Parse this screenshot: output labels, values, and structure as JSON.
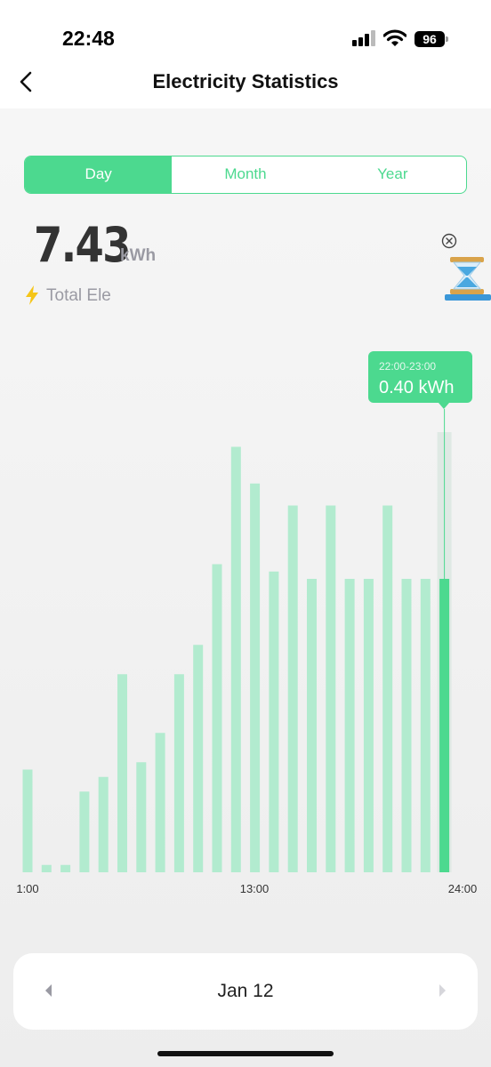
{
  "status_bar": {
    "time": "22:48",
    "battery": "96"
  },
  "header": {
    "title": "Electricity Statistics"
  },
  "tabs": [
    {
      "label": "Day",
      "active": true
    },
    {
      "label": "Month",
      "active": false
    },
    {
      "label": "Year",
      "active": false
    }
  ],
  "summary": {
    "value": "7.43",
    "unit": "kWh",
    "label": "Total Ele"
  },
  "tooltip": {
    "range": "22:00-23:00",
    "value": "0.40 kWh"
  },
  "date_nav": {
    "date": "Jan 12"
  },
  "colors": {
    "accent": "#4cd98f",
    "bar": "#b2ebcf",
    "bolt": "#f5c518"
  },
  "chart_data": {
    "type": "bar",
    "tick_labels": [
      "1:00",
      "13:00",
      "24:00"
    ],
    "categories": [
      "1",
      "2",
      "3",
      "4",
      "5",
      "6",
      "7",
      "8",
      "9",
      "10",
      "11",
      "12",
      "13",
      "14",
      "15",
      "16",
      "17",
      "18",
      "19",
      "20",
      "21",
      "22",
      "23",
      "24"
    ],
    "values": [
      0.14,
      0.01,
      0.01,
      0.11,
      0.13,
      0.27,
      0.15,
      0.19,
      0.27,
      0.31,
      0.42,
      0.58,
      0.53,
      0.41,
      0.5,
      0.4,
      0.5,
      0.4,
      0.4,
      0.5,
      0.4,
      0.4,
      0.4
    ],
    "highlight_index": 22,
    "ylim": [
      0,
      0.6
    ]
  }
}
